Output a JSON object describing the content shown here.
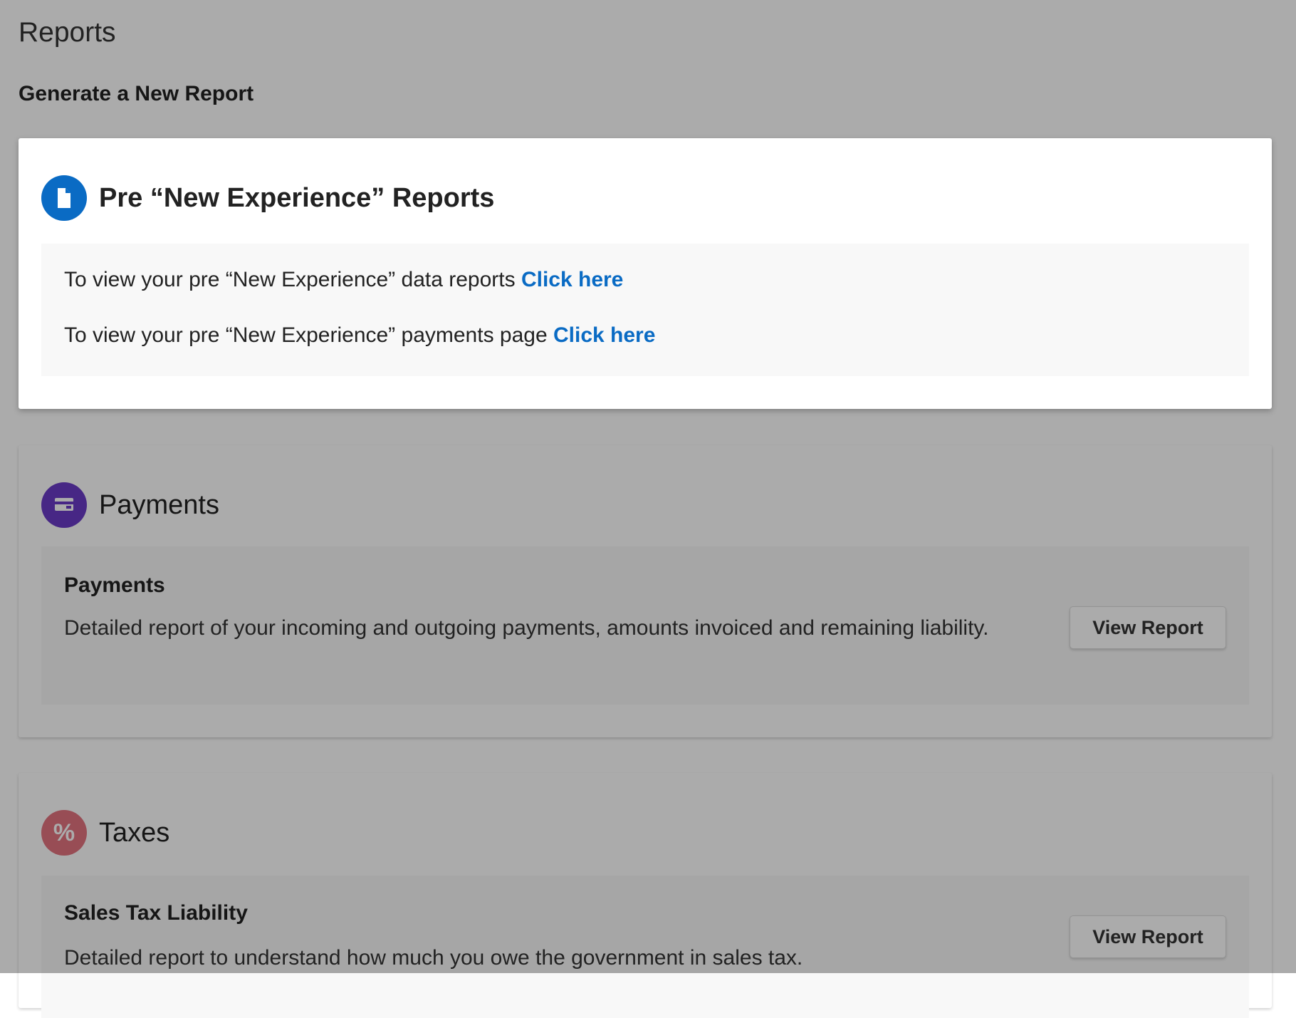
{
  "page": {
    "title": "Reports",
    "subtitle": "Generate a New Report"
  },
  "colors": {
    "link": "#0a6bc4",
    "legacy_icon": "#0a6bc4",
    "payments_icon": "#6a3bc6",
    "taxes_icon": "#e3737f"
  },
  "legacy_card": {
    "icon": "document-icon",
    "title": "Pre “New Experience” Reports",
    "line1_text": "To view your pre “New Experience” data reports ",
    "line1_link": "Click here",
    "line2_text": "To view your pre “New Experience” payments page ",
    "line2_link": "Click here"
  },
  "payments_card": {
    "icon": "wallet-icon",
    "title": "Payments",
    "report": {
      "name": "Payments",
      "description": "Detailed report of your incoming and outgoing payments, amounts invoiced and remaining liability.",
      "button": "View Report"
    }
  },
  "taxes_card": {
    "icon": "percent-icon",
    "icon_glyph": "%",
    "title": "Taxes",
    "report": {
      "name": "Sales Tax Liability",
      "description": "Detailed report to understand how much you owe the government in sales tax.",
      "button": "View Report"
    }
  }
}
